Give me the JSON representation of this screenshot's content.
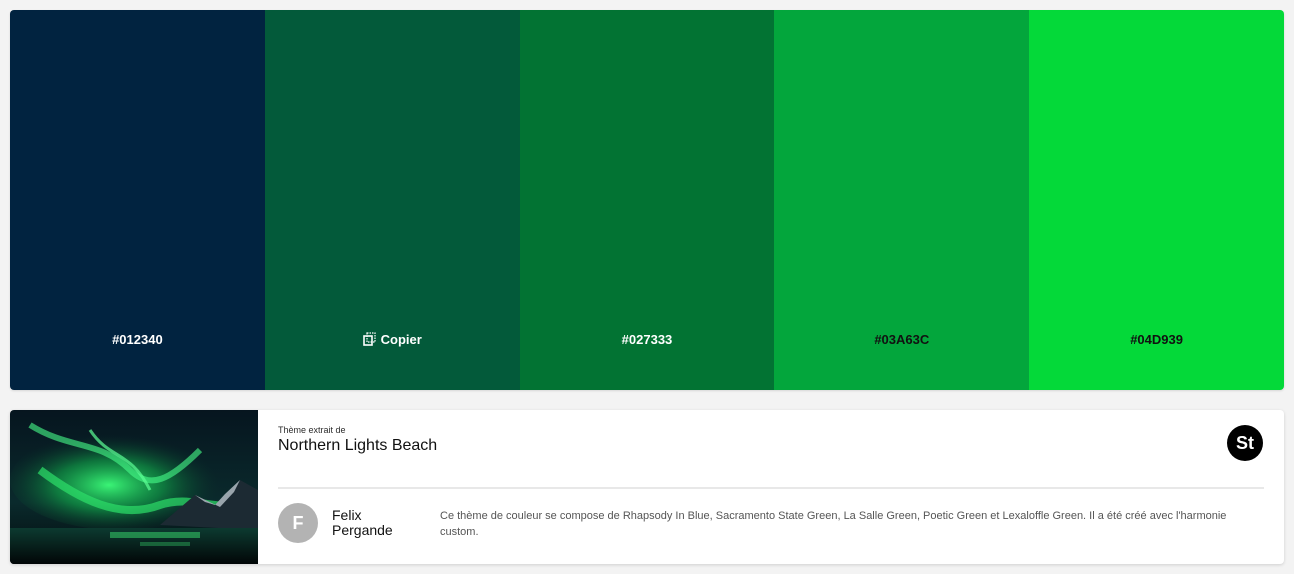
{
  "swatches": [
    {
      "color": "#012340",
      "label": "#012340",
      "text_color": "#ffffff",
      "icon": ""
    },
    {
      "color": "#035A3A",
      "label": "Copier",
      "text_color": "#ffffff",
      "icon": "copy-icon"
    },
    {
      "color": "#027333",
      "label": "#027333",
      "text_color": "#ffffff",
      "icon": ""
    },
    {
      "color": "#03A63C",
      "label": "#03A63C",
      "text_color": "#111111",
      "icon": ""
    },
    {
      "color": "#04D939",
      "label": "#04D939",
      "text_color": "#111111",
      "icon": ""
    }
  ],
  "theme": {
    "extracted_from": "Thème extrait de",
    "title": "Northern Lights Beach",
    "badge": "St",
    "author_initial": "F",
    "author_first": "Felix",
    "author_last": "Pergande",
    "description": "Ce thème de couleur se compose de Rhapsody In Blue, Sacramento State Green, La Salle Green, Poetic Green et Lexaloffle Green. Il a été créé avec l'harmonie custom."
  }
}
